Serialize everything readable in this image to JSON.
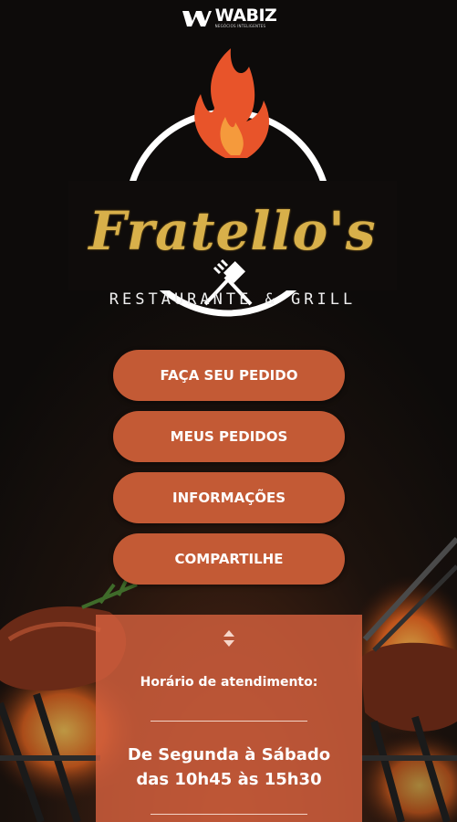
{
  "header": {
    "brand": "WABIZ",
    "tagline": "NEGÓCIOS INTELIGENTES"
  },
  "restaurant": {
    "name": "Fratello's",
    "subtitle": "RESTAURANTE & GRILL"
  },
  "menu": {
    "order": "FAÇA SEU PEDIDO",
    "my_orders": "MEUS PEDIDOS",
    "info": "INFORMAÇÕES",
    "share": "COMPARTILHE"
  },
  "hours": {
    "title": "Horário de atendimento:",
    "days": "De Segunda à Sábado",
    "time": "das 10h45 às 15h30"
  },
  "colors": {
    "button": "#c35a35",
    "card": "#d4603e",
    "gold": "#d8b04a",
    "flame": "#e8542a"
  }
}
